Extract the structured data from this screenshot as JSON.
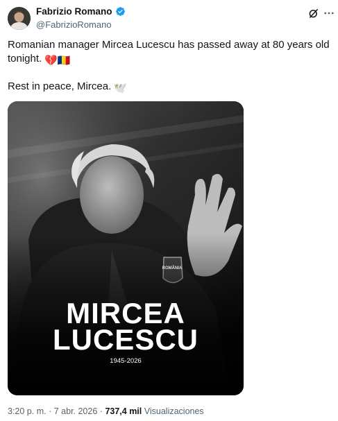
{
  "author": {
    "display_name": "Fabrizio Romano",
    "handle": "@FabrizioRomano"
  },
  "icons": {
    "avatar": "profile-photo",
    "verified": "verified-badge-icon",
    "grok": "grok-icon",
    "more": "more-options-icon"
  },
  "colors": {
    "verified_blue": "#1d9bf0",
    "secondary_text": "#536471",
    "primary_text": "#0f1419"
  },
  "tweet": {
    "line1": "Romanian manager Mircea Lucescu has passed away at 80 years old",
    "line2": "tonight.",
    "line2_emojis": "💔🇷🇴",
    "line3": "Rest in peace, Mircea.",
    "line3_emoji": "🕊️"
  },
  "media": {
    "name_line1": "MIRCEA",
    "name_line2": "LUCESCU",
    "years": "1945-2026",
    "badge_text": "ROMÂNIA",
    "style": "black-and-white portrait"
  },
  "meta": {
    "time": "3:20 p. m.",
    "separator": "·",
    "date": "7 abr. 2026",
    "views_count": "737,4 mil",
    "views_label": "Visualizaciones"
  }
}
